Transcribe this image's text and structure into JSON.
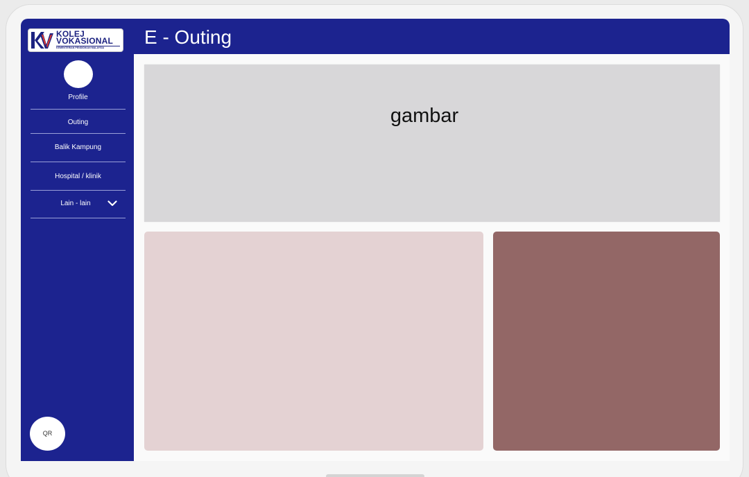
{
  "app": {
    "title": "E - Outing"
  },
  "logo": {
    "line1": "KOLEJ",
    "line2": "VOKASIONAL",
    "line3": "KEMENTERIAN PENDIDIKAN MALAYSIA",
    "icon": "kv-logo-mark"
  },
  "sidebar": {
    "items": [
      {
        "label": "Profile"
      },
      {
        "label": "Outing"
      },
      {
        "label": "Balik Kampung"
      },
      {
        "label": "Hospital / klinik"
      },
      {
        "label": "Lain - lain",
        "icon": "chevron-down-icon"
      }
    ],
    "qr_label": "QR"
  },
  "main": {
    "banner_text": "gambar"
  },
  "colors": {
    "primary": "#1c238f",
    "banner": "#d8d7d9",
    "card_left": "#e4d2d3",
    "card_right": "#936766"
  }
}
